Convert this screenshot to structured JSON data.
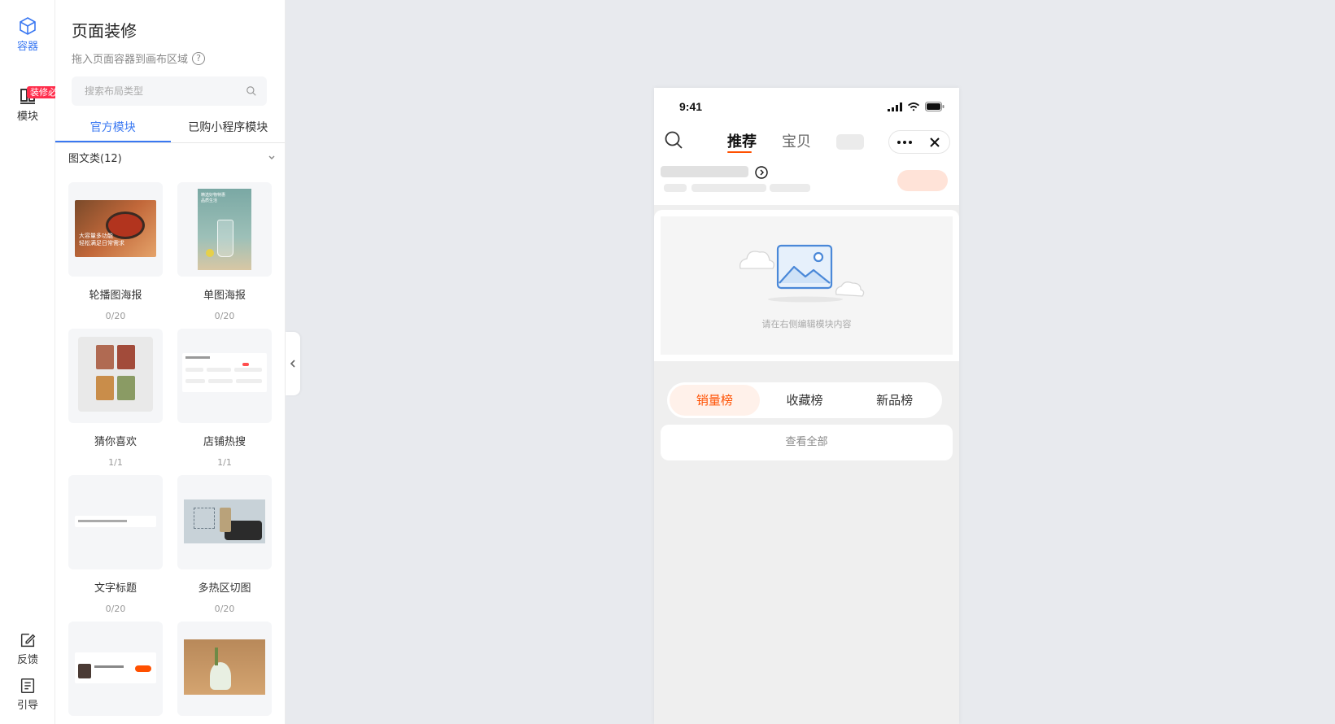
{
  "rail": {
    "container_label": "容器",
    "module_label": "模块",
    "module_badge": "装修必备",
    "feedback_label": "反馈",
    "guide_label": "引导"
  },
  "panel": {
    "title": "页面装修",
    "subtitle": "拖入页面容器到画布区域",
    "help_icon_text": "?",
    "search_placeholder": "搜索布局类型",
    "tabs": [
      "官方模块",
      "已购小程序模块"
    ],
    "section_title": "图文类(12)",
    "cards": [
      {
        "name": "轮播图海报",
        "count": "0/20",
        "thumb_text": "大容量多功能\n轻松满足日常需求"
      },
      {
        "name": "单图海报",
        "count": "0/20",
        "thumb_text": "精选好物特惠\n品质生活"
      },
      {
        "name": "猜你喜欢",
        "count": "1/1",
        "thumb_text": ""
      },
      {
        "name": "店铺热搜",
        "count": "1/1",
        "thumb_text": ""
      },
      {
        "name": "文字标题",
        "count": "0/20",
        "thumb_text": ""
      },
      {
        "name": "多热区切图",
        "count": "0/20",
        "thumb_text": ""
      },
      {
        "name": "",
        "count": "",
        "thumb_text": ""
      },
      {
        "name": "",
        "count": "",
        "thumb_text": ""
      }
    ]
  },
  "phone": {
    "time": "9:41",
    "nav_tabs": [
      "推荐",
      "宝贝"
    ],
    "image_hint": "请在右侧编辑模块内容",
    "rank_tabs": [
      "销量榜",
      "收藏榜",
      "新品榜"
    ],
    "view_all": "查看全部"
  },
  "colors": {
    "accent": "#3a78f2",
    "brand_orange": "#ff5000",
    "badge_red": "#ff2d4b"
  }
}
